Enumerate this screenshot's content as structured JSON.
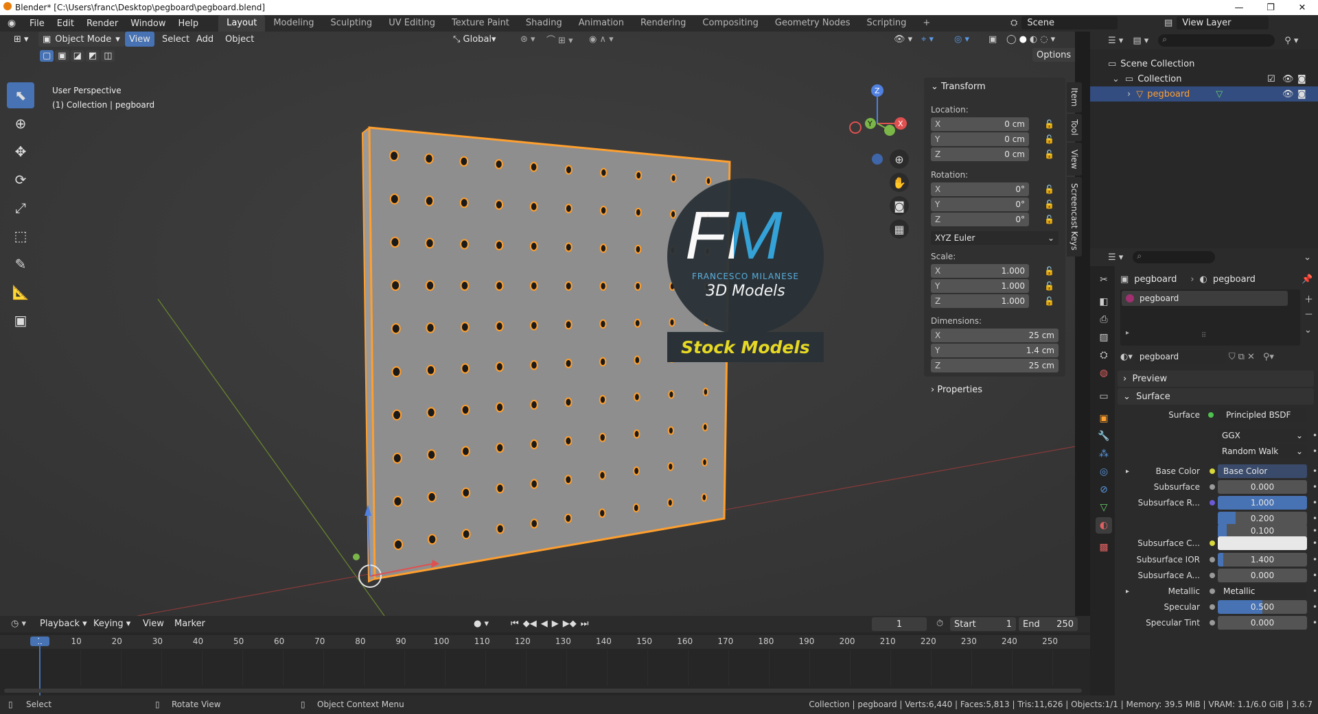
{
  "window": {
    "title": "Blender* [C:\\Users\\franc\\Desktop\\pegboard\\pegboard.blend]",
    "minimize": "—",
    "maximize": "❐",
    "close": "✕"
  },
  "menu": [
    "File",
    "Edit",
    "Render",
    "Window",
    "Help"
  ],
  "workspaces": [
    "Layout",
    "Modeling",
    "Sculpting",
    "UV Editing",
    "Texture Paint",
    "Shading",
    "Animation",
    "Rendering",
    "Compositing",
    "Geometry Nodes",
    "Scripting",
    "+"
  ],
  "scene": {
    "label": "Scene",
    "view_layer": "View Layer"
  },
  "viewport_header": {
    "mode": "Object Mode",
    "view": "View",
    "select": "Select",
    "add": "Add",
    "object": "Object",
    "orientation": "Global",
    "options": "Options"
  },
  "viewport_info": {
    "line1": "User Perspective",
    "line2": "(1) Collection | pegboard"
  },
  "watermark": {
    "letters": "FM",
    "name": "FRANCESCO MILANESE",
    "sub": "3D Models",
    "banner": "Stock Models"
  },
  "npanel": {
    "title": "Transform",
    "location_label": "Location:",
    "location": [
      {
        "k": "X",
        "v": "0 cm"
      },
      {
        "k": "Y",
        "v": "0 cm"
      },
      {
        "k": "Z",
        "v": "0 cm"
      }
    ],
    "rotation_label": "Rotation:",
    "rotation": [
      {
        "k": "X",
        "v": "0°"
      },
      {
        "k": "Y",
        "v": "0°"
      },
      {
        "k": "Z",
        "v": "0°"
      }
    ],
    "rotation_mode": "XYZ Euler",
    "scale_label": "Scale:",
    "scale": [
      {
        "k": "X",
        "v": "1.000"
      },
      {
        "k": "Y",
        "v": "1.000"
      },
      {
        "k": "Z",
        "v": "1.000"
      }
    ],
    "dimensions_label": "Dimensions:",
    "dimensions": [
      {
        "k": "X",
        "v": "25 cm"
      },
      {
        "k": "Y",
        "v": "1.4 cm"
      },
      {
        "k": "Z",
        "v": "25 cm"
      }
    ],
    "properties": "Properties"
  },
  "side_tabs": [
    "Item",
    "Tool",
    "View",
    "Screencast Keys"
  ],
  "outliner": {
    "scene_collection": "Scene Collection",
    "collection": "Collection",
    "object": "pegboard"
  },
  "properties": {
    "breadcrumb_obj": "pegboard",
    "breadcrumb_mat": "pegboard",
    "slot": "pegboard",
    "material": "pegboard",
    "preview": "Preview",
    "surface_panel": "Surface",
    "surface_label": "Surface",
    "surface_value": "Principled BSDF",
    "distribution": "GGX",
    "subsurface_method": "Random Walk",
    "rows": [
      {
        "label": "Base Color",
        "value": "Base Color",
        "kind": "link"
      },
      {
        "label": "Subsurface",
        "value": "0.000",
        "kind": "num"
      },
      {
        "label": "Subsurface R...",
        "value": "1.000",
        "kind": "num"
      },
      {
        "label": "",
        "value": "0.200",
        "kind": "num"
      },
      {
        "label": "",
        "value": "0.100",
        "kind": "num"
      },
      {
        "label": "Subsurface C...",
        "value": "",
        "kind": "color"
      },
      {
        "label": "Subsurface IOR",
        "value": "1.400",
        "kind": "num"
      },
      {
        "label": "Subsurface A...",
        "value": "0.000",
        "kind": "num"
      },
      {
        "label": "Metallic",
        "value": "Metallic",
        "kind": "link"
      },
      {
        "label": "Specular",
        "value": "0.500",
        "kind": "num"
      },
      {
        "label": "Specular Tint",
        "value": "0.000",
        "kind": "num"
      }
    ]
  },
  "timeline": {
    "playback": "Playback",
    "keying": "Keying",
    "view": "View",
    "marker": "Marker",
    "current_frame": "1",
    "start_label": "Start",
    "start": "1",
    "end_label": "End",
    "end": "250",
    "ticks": [
      "1",
      "10",
      "20",
      "30",
      "40",
      "50",
      "60",
      "70",
      "80",
      "90",
      "100",
      "110",
      "120",
      "130",
      "140",
      "150",
      "160",
      "170",
      "180",
      "190",
      "200",
      "210",
      "220",
      "230",
      "240",
      "250"
    ]
  },
  "statusbar": {
    "select": "Select",
    "rotate": "Rotate View",
    "context": "Object Context Menu",
    "stats": "Collection | pegboard | Verts:6,440 | Faces:5,813 | Tris:11,626 | Objects:1/1 | Memory: 39.5 MiB | VRAM: 1.1/6.0 GiB | 3.6.7"
  },
  "colors": {
    "accent": "#4772b3",
    "selection": "#ff9f2e",
    "board": "#8e8e8e"
  }
}
